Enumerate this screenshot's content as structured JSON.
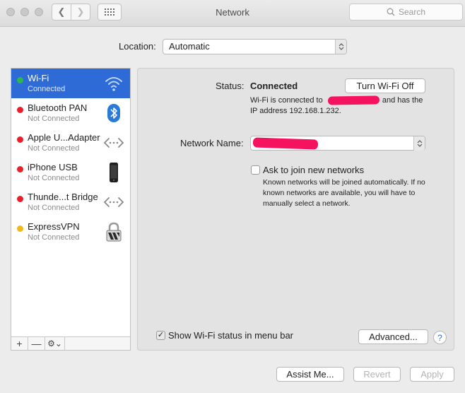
{
  "window": {
    "title": "Network",
    "search_placeholder": "Search"
  },
  "location": {
    "label": "Location:",
    "value": "Automatic"
  },
  "sidebar": {
    "items": [
      {
        "name": "Wi-Fi",
        "status": "Connected",
        "dot_color": "#2db84d",
        "icon": "wifi-icon",
        "selected": true
      },
      {
        "name": "Bluetooth PAN",
        "status": "Not Connected",
        "dot_color": "#e8202a",
        "icon": "bluetooth-icon"
      },
      {
        "name": "Apple U...Adapter",
        "status": "Not Connected",
        "dot_color": "#e8202a",
        "icon": "ethernet-arrows-icon"
      },
      {
        "name": "iPhone USB",
        "status": "Not Connected",
        "dot_color": "#e8202a",
        "icon": "iphone-icon"
      },
      {
        "name": "Thunde...t Bridge",
        "status": "Not Connected",
        "dot_color": "#e8202a",
        "icon": "ethernet-arrows-icon"
      },
      {
        "name": "ExpressVPN",
        "status": "Not Connected",
        "dot_color": "#f3b91c",
        "icon": "lock-icon"
      }
    ],
    "footer": {
      "add": "+",
      "remove": "—",
      "gear": "⚙︎⌄"
    }
  },
  "details": {
    "status_label": "Status:",
    "status_value": "Connected",
    "turn_off_button": "Turn Wi-Fi Off",
    "connection_desc_prefix": "Wi-Fi is connected to",
    "connection_desc_suffix": "and has the IP address 192.168.1.232.",
    "network_name_label": "Network Name:",
    "ask_label": "Ask to join new networks",
    "ask_checked": false,
    "known_desc": "Known networks will be joined automatically. If no known networks are available, you will have to manually select a network.",
    "menubar_label": "Show Wi-Fi status in menu bar",
    "menubar_checked": true,
    "advanced_button": "Advanced...",
    "help": "?"
  },
  "buttons": {
    "assist": "Assist Me...",
    "revert": "Revert",
    "apply": "Apply"
  },
  "colors": {
    "accent": "#2e6bd6",
    "redaction": "#f5125f"
  }
}
